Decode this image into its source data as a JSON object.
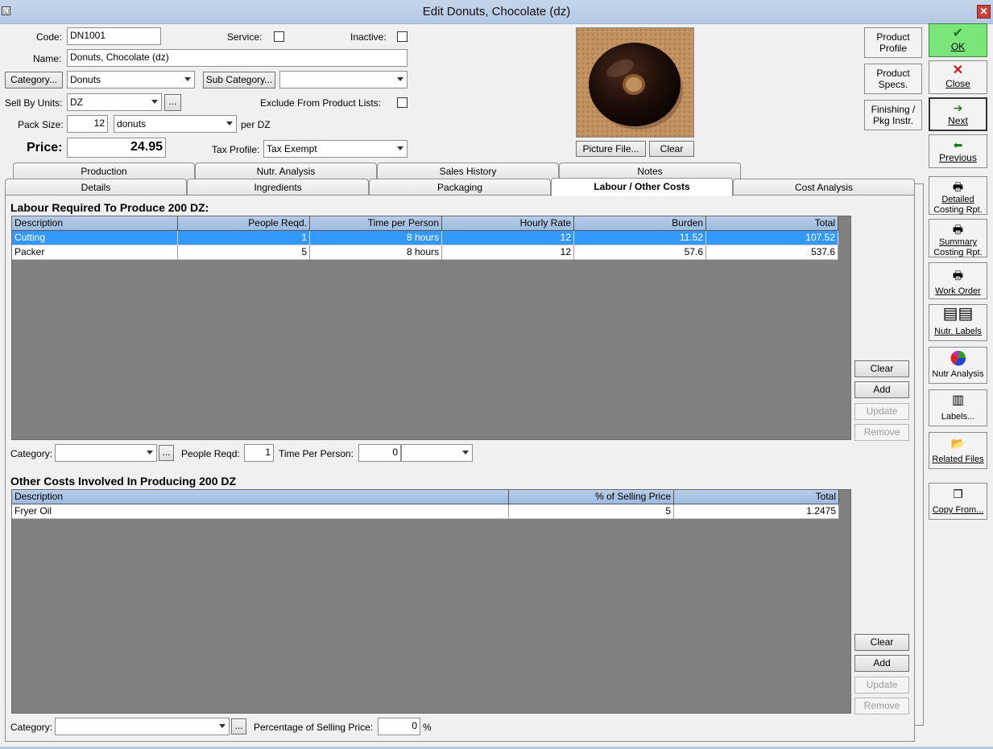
{
  "window": {
    "title": "Edit Donuts, Chocolate (dz)",
    "close_glyph": "✕"
  },
  "form": {
    "code_label": "Code:",
    "code_value": "DN1001",
    "service_label": "Service:",
    "inactive_label": "Inactive:",
    "name_label": "Name:",
    "name_value": "Donuts, Chocolate (dz)",
    "category_button": "Category...",
    "category_value": "Donuts",
    "subcategory_button": "Sub Category...",
    "subcategory_value": "",
    "sell_by_label": "Sell By Units:",
    "sell_by_value": "DZ",
    "ellipsis": "...",
    "exclude_label": "Exclude From Product Lists:",
    "pack_size_label": "Pack Size:",
    "pack_size_value": "12",
    "pack_unit_value": "donuts",
    "per_label": "per DZ",
    "price_label": "Price:",
    "price_value": "24.95",
    "tax_label": "Tax Profile:",
    "tax_value": "Tax Exempt"
  },
  "picture": {
    "file_button": "Picture File...",
    "clear_button": "Clear"
  },
  "right_buttons": {
    "product_profile": "Product Profile",
    "product_specs": "Product Specs.",
    "finishing": "Finishing / Pkg Instr.",
    "ok": "OK",
    "close": "Close",
    "next": "Next",
    "previous": "Previous",
    "detailed_1": "Detailed",
    "detailed_2": "Costing Rpt.",
    "summary_1": "Summary",
    "summary_2": "Costing Rpt.",
    "work_order": "Work Order",
    "nutr_labels": "Nutr. Labels",
    "nutr_analysis": "Nutr Analysis",
    "labels": "Labels...",
    "related_files": "Related Files",
    "copy_from": "Copy From..."
  },
  "tabs": {
    "row1": [
      "Production",
      "Nutr. Analysis",
      "Sales History",
      "Notes"
    ],
    "row2": [
      "Details",
      "Ingredients",
      "Packaging",
      "Labour / Other Costs",
      "Cost Analysis"
    ],
    "active": "Labour / Other Costs"
  },
  "labour": {
    "title": "Labour Required To Produce 200 DZ:",
    "columns": [
      "Description",
      "People Reqd.",
      "Time per Person",
      "Hourly Rate",
      "Burden",
      "Total"
    ],
    "rows": [
      [
        "Cutting",
        "1",
        "8 hours",
        "12",
        "11.52",
        "107.52"
      ],
      [
        "Packer",
        "5",
        "8 hours",
        "12",
        "57.6",
        "537.6"
      ]
    ],
    "buttons": [
      "Clear",
      "Add",
      "Update",
      "Remove"
    ],
    "category_label": "Category:",
    "people_label": "People Reqd:",
    "people_value": "1",
    "time_label": "Time Per Person:",
    "time_value": "0",
    "time_unit": ""
  },
  "other": {
    "title": "Other Costs Involved In Producing 200 DZ",
    "columns": [
      "Description",
      "% of Selling Price",
      "Total"
    ],
    "rows": [
      [
        "Fryer Oil",
        "5",
        "1.2475"
      ]
    ],
    "buttons": [
      "Clear",
      "Add",
      "Update",
      "Remove"
    ],
    "category_label": "Category:",
    "pct_label": "Percentage of Selling Price:",
    "pct_value": "0",
    "pct_sign": "%"
  }
}
